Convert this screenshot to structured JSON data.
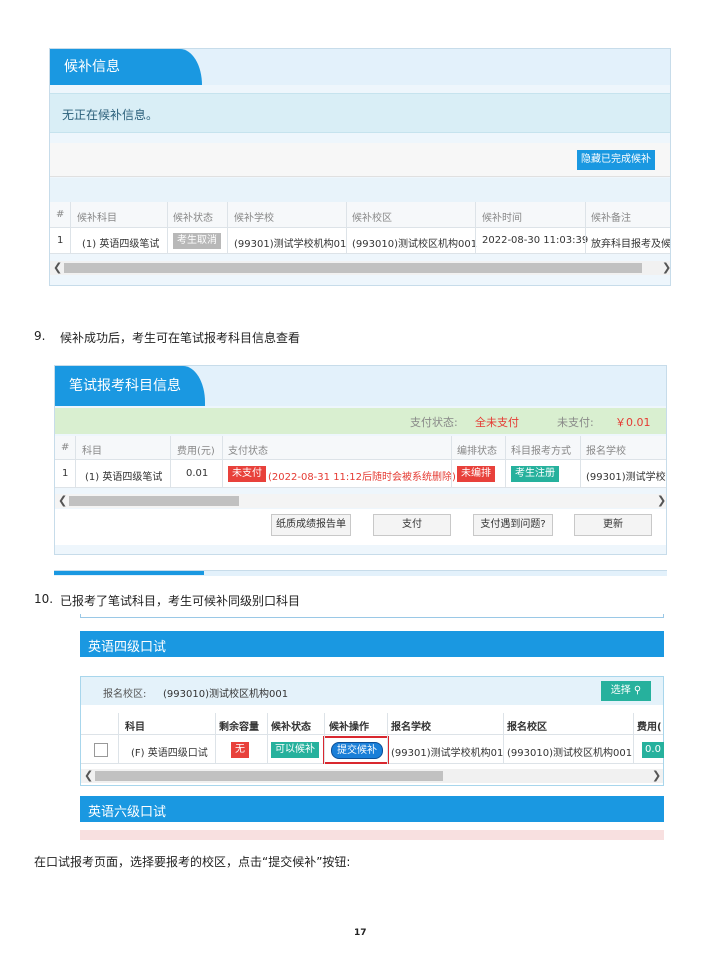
{
  "panel1": {
    "title": "候补信息",
    "notice": "无正在候补信息。",
    "hide_button": "隐藏已完成候补",
    "headers": [
      "#",
      "候补科目",
      "候补状态",
      "候补学校",
      "候补校区",
      "候补时间",
      "候补备注"
    ],
    "row": {
      "index": "1",
      "subject": "(1) 英语四级笔试",
      "status": "考生取消",
      "school": "(99301)测试学校机构01",
      "campus": "(993010)测试校区机构001",
      "time": "2022-08-30 11:03:39",
      "remark": "放弃科目报考及候补"
    }
  },
  "step9": {
    "num": "9.",
    "text": "候补成功后，考生可在笔试报考科目信息查看"
  },
  "panel2": {
    "title": "笔试报考科目信息",
    "pay_status_label": "支付状态:",
    "pay_status_value": "全未支付",
    "unpaid_label": "未支付:",
    "unpaid_value": "￥0.01",
    "headers": [
      "#",
      "科目",
      "费用(元)",
      "支付状态",
      "编排状态",
      "科目报考方式",
      "报名学校"
    ],
    "row": {
      "index": "1",
      "subject": "(1) 英语四级笔试",
      "fee": "0.01",
      "pay_badge": "未支付",
      "pay_note": "(2022-08-31 11:12后随时会被系统删除)",
      "arrange_badge": "未编排",
      "method_badge": "考生注册",
      "school": "(99301)测试学校机"
    },
    "buttons": [
      "纸质成绩报告单",
      "支付",
      "支付遇到问题?",
      "更新"
    ]
  },
  "step10": {
    "num": "10.",
    "text": "已报考了笔试科目，考生可候补同级别口科目"
  },
  "panel3": {
    "title": "英语四级口试",
    "campus_label": "报名校区:",
    "campus_value": "(993010)测试校区机构001",
    "select_button": "选择",
    "headers": [
      "科目",
      "剩余容量",
      "候补状态",
      "候补操作",
      "报名学校",
      "报名校区",
      "费用("
    ],
    "row": {
      "subject": "(F) 英语四级口试",
      "capacity_badge": "无",
      "status_badge": "可以候补",
      "action_button": "提交候补",
      "school": "(99301)测试学校机构01",
      "campus": "(993010)测试校区机构001",
      "fee_badge": "0.0"
    },
    "next_title": "英语六级口试"
  },
  "instruction": "在口试报考页面，选择要报考的校区，点击“提交候补”按钮:",
  "page_number": "17",
  "colors": {
    "tab_blue": "#1a98e1",
    "red": "#e8413b",
    "teal": "#26b19d",
    "gray_badge": "#b8b8b8"
  }
}
